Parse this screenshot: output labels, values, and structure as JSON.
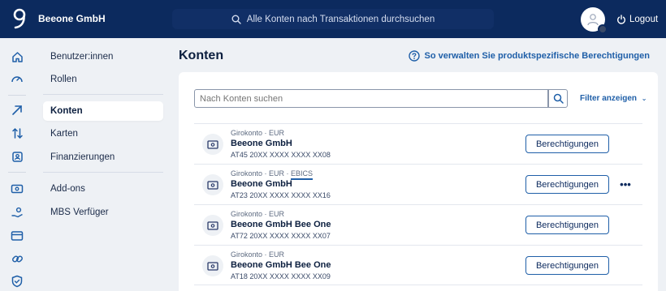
{
  "header": {
    "company": "Beeone GmbH",
    "search_placeholder": "Alle Konten nach Transaktionen durchsuchen",
    "logout_label": "Logout"
  },
  "rail": {
    "icons": [
      "home-icon",
      "dashboard-gauge-icon",
      "arrow-up-right-icon",
      "transfer-arrows-icon",
      "contact-card-icon",
      "account-card-icon",
      "hand-coin-icon",
      "cards-icon",
      "link-icon",
      "shield-icon"
    ]
  },
  "subnav": {
    "items": [
      {
        "label": "Benutzer:innen",
        "active": false
      },
      {
        "label": "Rollen",
        "active": false
      },
      {
        "label": "Konten",
        "active": true
      },
      {
        "label": "Karten",
        "active": false
      },
      {
        "label": "Finanzierungen",
        "active": false
      },
      {
        "label": "Add-ons",
        "active": false
      },
      {
        "label": "MBS Verfüger",
        "active": false
      }
    ]
  },
  "main": {
    "title": "Konten",
    "help_link": "So verwalten Sie produktspezifische Berechtigungen",
    "search_placeholder": "Nach Konten suchen",
    "filter_label": "Filter anzeigen",
    "button_label": "Berechtigungen",
    "more_label": "•••",
    "accounts": [
      {
        "type": "Girokonto · EUR",
        "ebics": "",
        "name": "Beeone GmbH",
        "iban": "AT45 20XX XXXX XXXX XX08"
      },
      {
        "type": "Girokonto · EUR · ",
        "ebics": "EBICS",
        "name": "Beeone GmbH",
        "iban": "AT23 20XX XXXX XXXX XX16"
      },
      {
        "type": "Girokonto · EUR",
        "ebics": "",
        "name": "Beeone GmbH Bee One",
        "iban": "AT72 20XX XXXX XXXX XX07"
      },
      {
        "type": "Girokonto · EUR",
        "ebics": "",
        "name": "Beeone GmbH Bee One",
        "iban": "AT18 20XX XXXX XXXX XX09"
      }
    ]
  },
  "colors": {
    "topbar": "#0c2a5e",
    "accent": "#1f5fa8",
    "background": "#eef1f5"
  }
}
